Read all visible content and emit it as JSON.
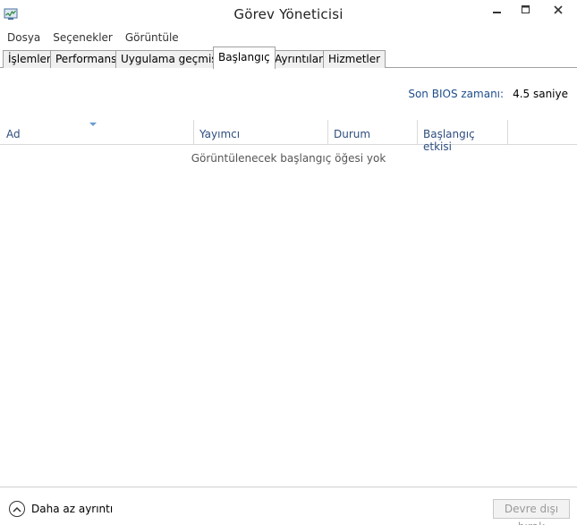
{
  "window": {
    "title": "Görev Yöneticisi",
    "icon": "task-manager-icon"
  },
  "menu": {
    "items": [
      "Dosya",
      "Seçenekler",
      "Görüntüle"
    ]
  },
  "tabs": [
    {
      "label": "İşlemler",
      "active": false
    },
    {
      "label": "Performans",
      "active": false
    },
    {
      "label": "Uygulama geçmişi",
      "active": false
    },
    {
      "label": "Başlangıç",
      "active": true
    },
    {
      "label": "Ayrıntılar",
      "active": false
    },
    {
      "label": "Hizmetler",
      "active": false
    }
  ],
  "bios": {
    "label": "Son BIOS zamanı:",
    "value": "4.5 saniye"
  },
  "table": {
    "columns": [
      "Ad",
      "Yayımcı",
      "Durum",
      "Başlangıç etkisi"
    ],
    "sorted_column": "Ad",
    "empty_message": "Görüntülenecek başlangıç öğesi yok"
  },
  "footer": {
    "fewer_details": "Daha az ayrıntı",
    "disable_button": "Devre dışı bırak",
    "disable_enabled": false
  },
  "colors": {
    "header_text": "#2e4e7e",
    "bios_label": "#1e4e8c",
    "border": "#a0a0a0"
  }
}
